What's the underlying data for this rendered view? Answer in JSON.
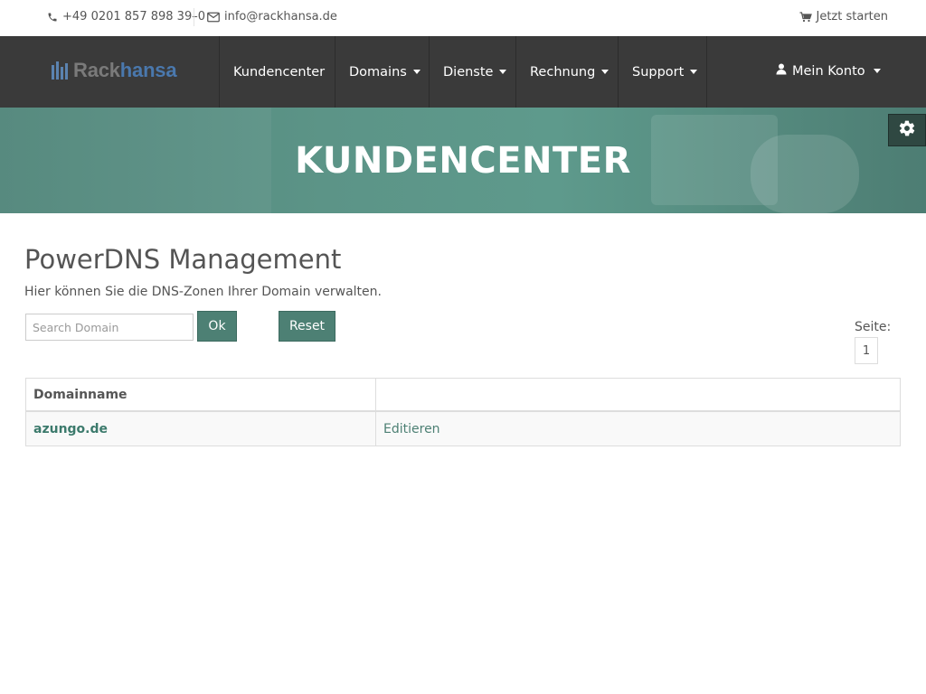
{
  "topbar": {
    "phone": "+49 0201 857 898 39–0",
    "email": "info@rackhansa.de",
    "cta": "Jetzt starten"
  },
  "brand": {
    "part1": "Rack",
    "part2": "hansa",
    "color_primary": "#4a78ad",
    "color_secondary": "#7a7a7a"
  },
  "nav": {
    "items": [
      {
        "label": "Kundencenter"
      },
      {
        "label": "Domains"
      },
      {
        "label": "Dienste"
      },
      {
        "label": "Rechnung"
      },
      {
        "label": "Support"
      }
    ],
    "account": "Mein Konto"
  },
  "banner": {
    "title": "KUNDENCENTER"
  },
  "main": {
    "title": "PowerDNS Management",
    "description": "Hier können Sie die DNS-Zonen Ihrer Domain verwalten.",
    "search": {
      "placeholder": "Search Domain",
      "value": ""
    },
    "ok_label": "Ok",
    "reset_label": "Reset",
    "pagination": {
      "label": "Seite:",
      "current": "1"
    },
    "table": {
      "headers": [
        "Domainname",
        ""
      ],
      "rows": [
        {
          "domain": "azungo.de",
          "action": "Editieren"
        }
      ]
    }
  },
  "colors": {
    "accent": "#4d8074",
    "navbar": "#3a3a3a",
    "banner": "#5c9487"
  },
  "icons": {
    "phone": "phone-icon",
    "email": "envelope-icon",
    "cart": "shopping-cart-icon",
    "user": "user-icon",
    "settings": "gear-icon"
  }
}
